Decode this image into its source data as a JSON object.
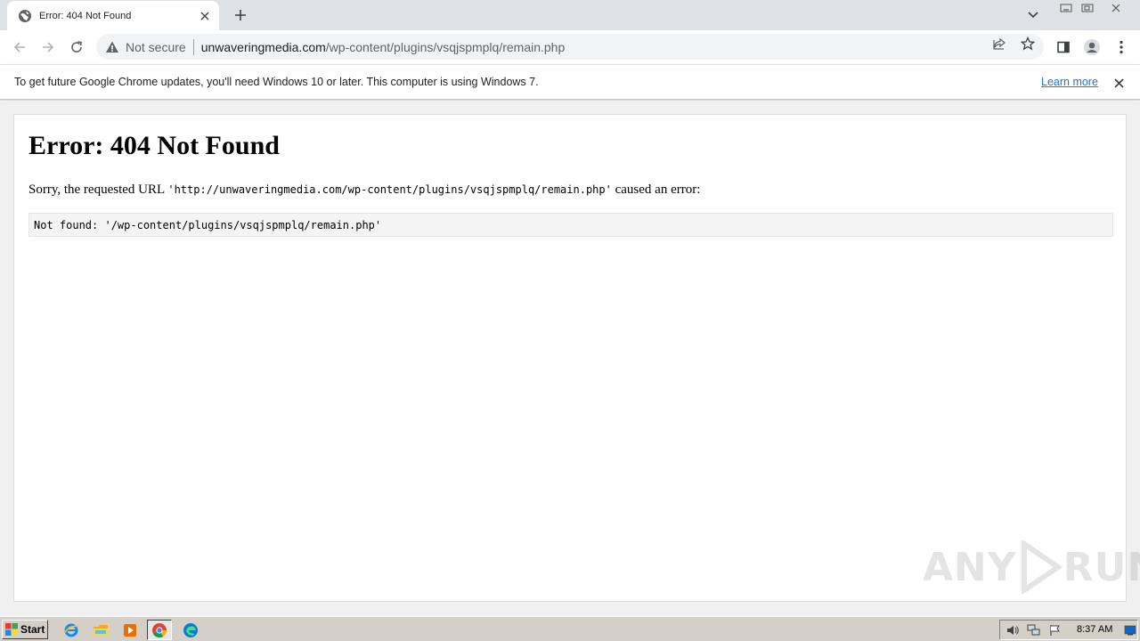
{
  "browser": {
    "tab": {
      "title": "Error: 404 Not Found"
    },
    "omnibox": {
      "security_label": "Not secure",
      "url_host": "unwaveringmedia.com",
      "url_path": "/wp-content/plugins/vsqjspmplq/remain.php"
    }
  },
  "infobar": {
    "message": "To get future Google Chrome updates, you'll need Windows 10 or later. This computer is using Windows 7.",
    "link_label": "Learn more"
  },
  "page": {
    "heading": "Error: 404 Not Found",
    "sorry_prefix": "Sorry, the requested URL ",
    "requested_url": "'http://unwaveringmedia.com/wp-content/plugins/vsqjspmplq/remain.php'",
    "sorry_suffix": " caused an error:",
    "detail": "Not found: '/wp-content/plugins/vsqjspmplq/remain.php'"
  },
  "watermark": {
    "text_left": "ANY",
    "text_right": "RUN"
  },
  "taskbar": {
    "start_label": "Start",
    "apps": [
      "internet-explorer-icon",
      "file-explorer-icon",
      "media-player-icon",
      "chrome-icon",
      "edge-icon"
    ],
    "clock": "8:37 AM"
  },
  "colors": {
    "tabstrip": "#dee1e6",
    "omnibox": "#f1f3f4",
    "link": "#1a73e8",
    "taskbar": "#d4d0c8"
  }
}
